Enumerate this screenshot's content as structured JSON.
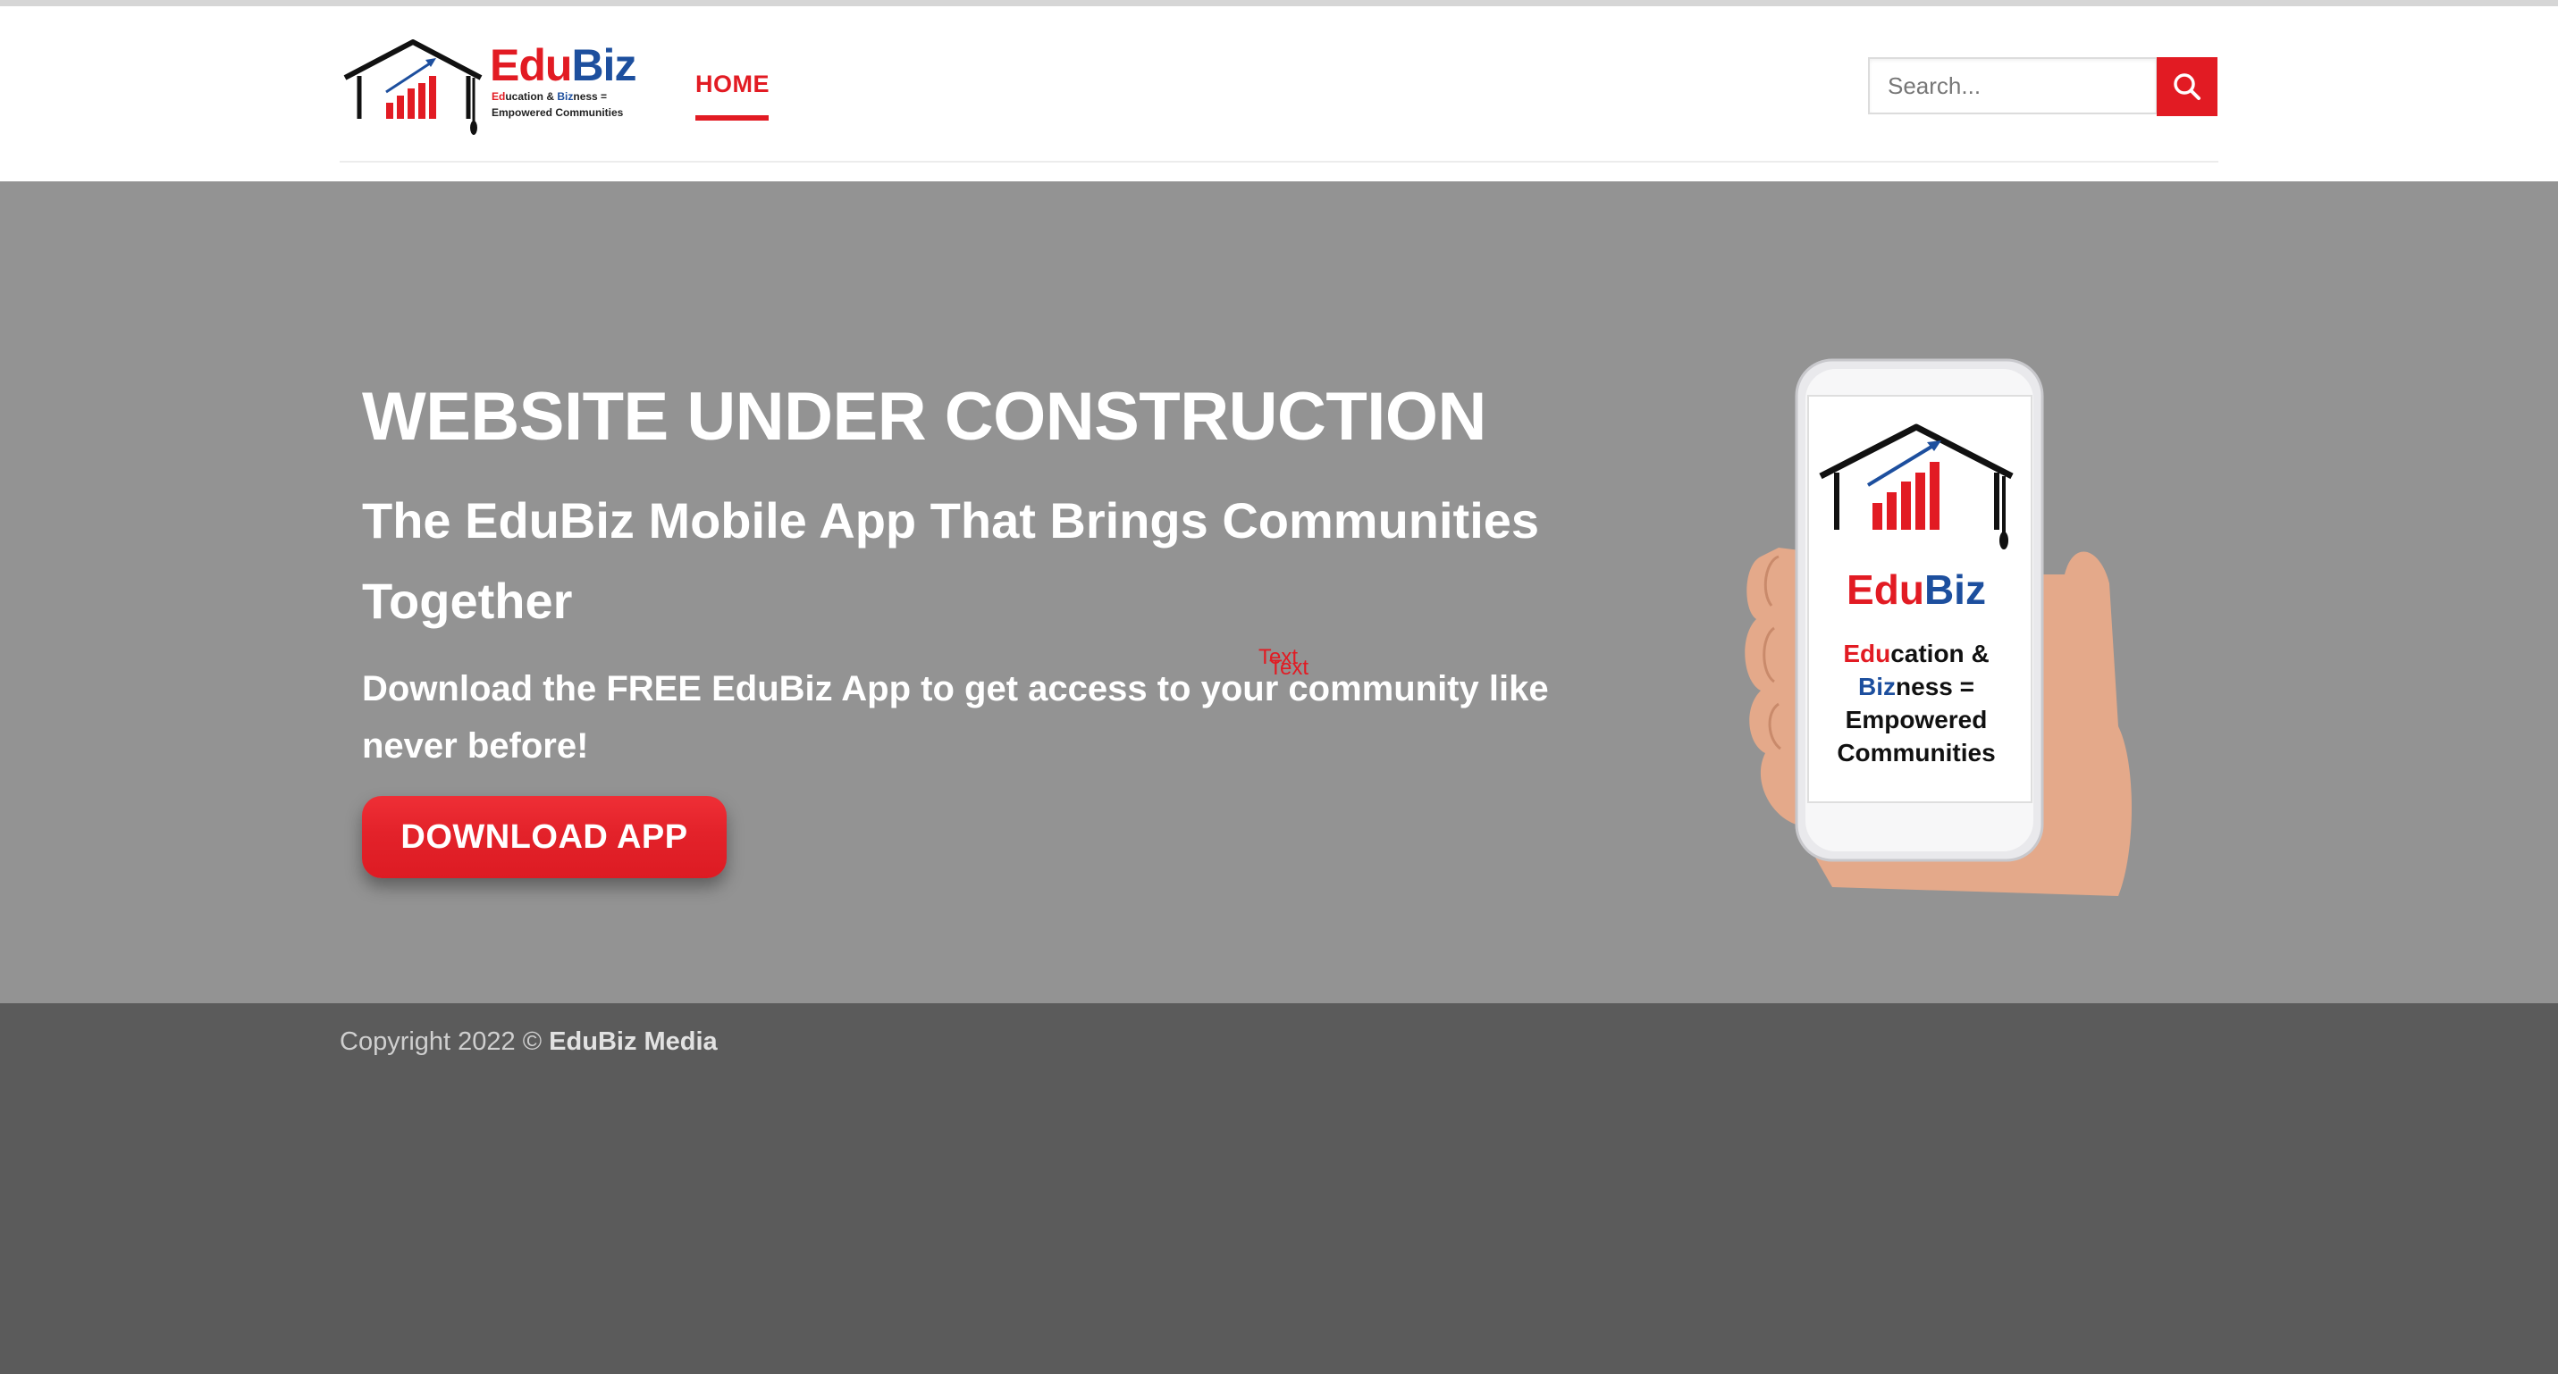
{
  "brand": {
    "logo_name_part1": "Edu",
    "logo_name_part2": "Biz",
    "logo_tagline_ed": "Ed",
    "logo_tagline_ucation": "ucation & ",
    "logo_tagline_biz": "Biz",
    "logo_tagline_ness": "ness =",
    "logo_tagline_line2": "Empowered Communities"
  },
  "nav": {
    "home_label": "HOME"
  },
  "search": {
    "placeholder": "Search..."
  },
  "hero": {
    "title": "WEBSITE UNDER CONSTRUCTION",
    "subtitle": "The EduBiz Mobile App That Brings Communities Together",
    "text": "Download the FREE EduBiz App to get access to your community like never before!",
    "red_label_1": "Text",
    "red_label_2": "Text",
    "button_label": "DOWNLOAD APP"
  },
  "phone_screen": {
    "brand_part1": "Edu",
    "brand_part2": "Biz",
    "tag_ed": "Edu",
    "tag_ucation": "cation &",
    "tag_biz": "Biz",
    "tag_ness": "ness =",
    "tag_line3": "Empowered",
    "tag_line4": "Communities"
  },
  "footer": {
    "copyright_prefix": "Copyright 2022 © ",
    "company": "EduBiz Media"
  },
  "colors": {
    "accent_red": "#e21b23",
    "brand_blue": "#1d4f9e",
    "hero_bg": "#939393",
    "footer_bg": "#5b5b5b"
  },
  "icons": {
    "search": "search-icon",
    "logo_mark": "graduation-cap-chart-icon"
  }
}
